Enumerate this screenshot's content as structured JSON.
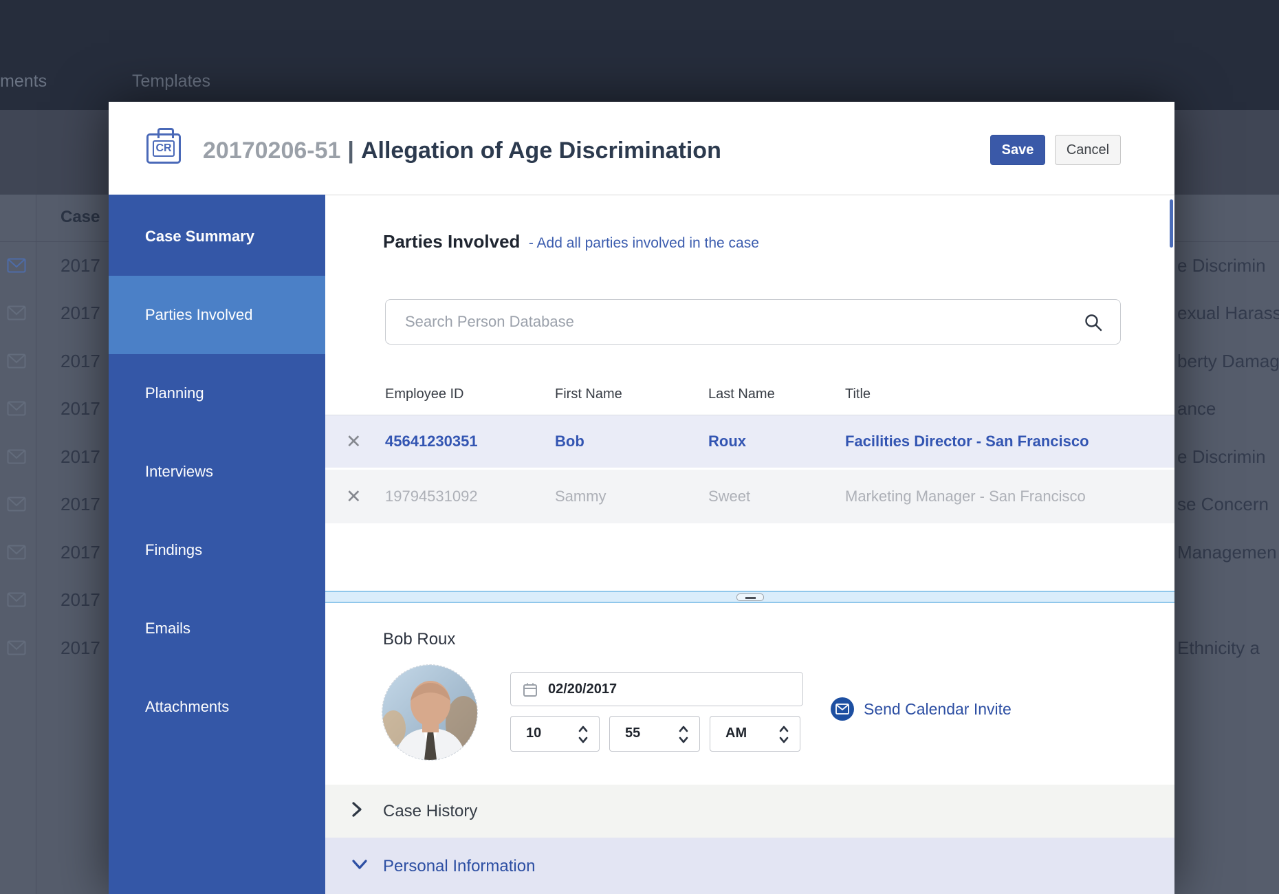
{
  "background": {
    "nav_items": [
      {
        "label": "ments"
      },
      {
        "label": "Templates"
      }
    ],
    "table_header": "Case",
    "left_rows": [
      {
        "case": "2017"
      },
      {
        "case": "2017"
      },
      {
        "case": "2017"
      },
      {
        "case": "2017"
      },
      {
        "case": "2017"
      },
      {
        "case": "2017"
      },
      {
        "case": "2017"
      },
      {
        "case": "2017"
      },
      {
        "case": "2017"
      }
    ],
    "right_fragments": [
      {
        "text": "e Discrimin"
      },
      {
        "text": "exual Harass"
      },
      {
        "text": "berty Damag"
      },
      {
        "text": "ance"
      },
      {
        "text": "e Discrimin"
      },
      {
        "text": "se Concern"
      },
      {
        "text": "Managemen"
      },
      {
        "text": ""
      },
      {
        "text": "Ethnicity a"
      }
    ]
  },
  "modal": {
    "badge": "CR",
    "case_id": "20170206-51",
    "separator": "|",
    "case_title": "Allegation of Age Discrimination",
    "save_label": "Save",
    "cancel_label": "Cancel",
    "sidebar": {
      "items": [
        {
          "label": "Case Summary"
        },
        {
          "label": "Parties Involved"
        },
        {
          "label": "Planning"
        },
        {
          "label": "Interviews"
        },
        {
          "label": "Findings"
        },
        {
          "label": "Emails"
        },
        {
          "label": "Attachments"
        }
      ]
    },
    "content": {
      "heading": "Parties Involved",
      "subheading": "- Add all parties involved in the case",
      "search_placeholder": "Search Person Database",
      "table": {
        "columns": [
          "Employee ID",
          "First Name",
          "Last Name",
          "Title"
        ],
        "delete_glyph": "✕",
        "rows": [
          {
            "employee_id": "45641230351",
            "first_name": "Bob",
            "last_name": "Roux",
            "title": "Facilities Director - San Francisco",
            "state": "selected"
          },
          {
            "employee_id": "19794531092",
            "first_name": "Sammy",
            "last_name": "Sweet",
            "title": "Marketing Manager - San Francisco",
            "state": "muted"
          }
        ]
      },
      "detail": {
        "person_name": "Bob Roux",
        "date_value": "02/20/2017",
        "hour_value": "10",
        "minute_value": "55",
        "meridiem_value": "AM",
        "send_invite_label": "Send Calendar Invite"
      },
      "sections": [
        {
          "label": "Case History",
          "state": "collapsed"
        },
        {
          "label": "Personal Information",
          "state": "expanded"
        }
      ]
    }
  },
  "colors": {
    "navbar": "#262d3c",
    "sidebar": "#3457a7",
    "sidebar_active": "#4b80c7",
    "primary_button": "#3a59a8",
    "link_blue": "#2d4fa3",
    "selected_row_bg": "#eaecf7",
    "selected_row_text": "#3355b2",
    "muted_row_text": "#adb0b7",
    "splitter": "#daedfb",
    "section_expanded_bg": "#e3e5f3",
    "title_gray": "#9aa0a8",
    "title_dark": "#2c3a4e"
  }
}
